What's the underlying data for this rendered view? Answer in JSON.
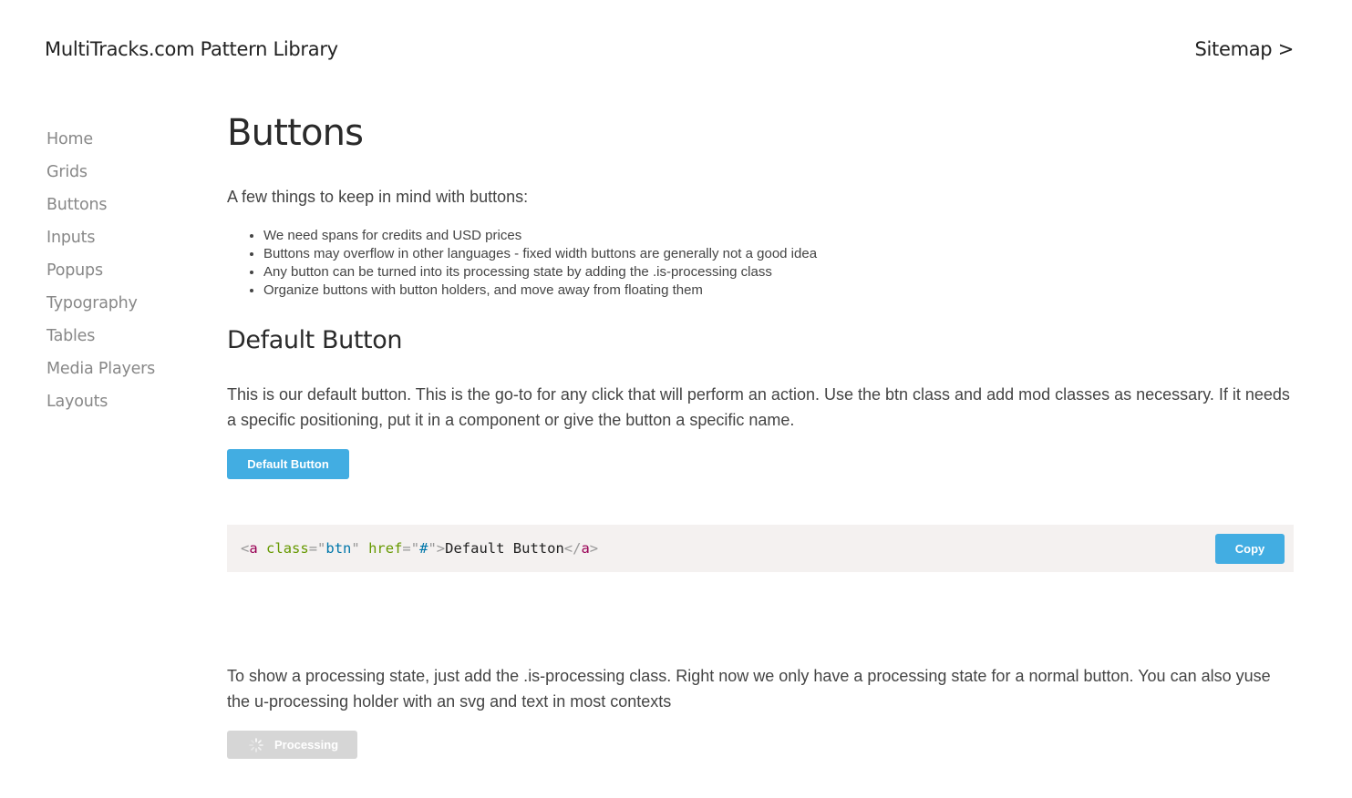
{
  "header": {
    "site_title": "MultiTracks.com Pattern Library",
    "sitemap_link": "Sitemap >"
  },
  "sidebar": {
    "items": [
      {
        "label": "Home"
      },
      {
        "label": "Grids"
      },
      {
        "label": "Buttons"
      },
      {
        "label": "Inputs"
      },
      {
        "label": "Popups"
      },
      {
        "label": "Typography"
      },
      {
        "label": "Tables"
      },
      {
        "label": "Media Players"
      },
      {
        "label": "Layouts"
      }
    ]
  },
  "main": {
    "title": "Buttons",
    "intro": "A few things to keep in mind with buttons:",
    "notes": [
      "We need spans for credits and USD prices",
      "Buttons may overflow in other languages - fixed width buttons are generally not a good idea",
      "Any button can be turned into its processing state by adding the .is-processing class",
      "Organize buttons with button holders, and move away from floating them"
    ],
    "default_section": {
      "title": "Default Button",
      "description": "This is our default button. This is the go-to for any click that will perform an action. Use the btn class and add mod classes as necessary. If it needs a specific positioning, put it in a component or give the button a specific name.",
      "button_label": "Default Button",
      "code": {
        "open_lt": "<",
        "tag": "a",
        "attr_class": "class",
        "eq": "=",
        "quote": "\"",
        "class_value": "btn",
        "attr_href": "href",
        "href_value": "#",
        "gt": ">",
        "text": "Default Button",
        "close_open": "</",
        "close_tag": "a",
        "close_gt": ">"
      },
      "copy_label": "Copy"
    },
    "processing_section": {
      "description": "To show a processing state, just add the .is-processing class. Right now we only have a processing state for a normal button. You can also yuse the u-processing holder with an svg and text in most contexts",
      "button_label": "Processing"
    }
  },
  "colors": {
    "accent": "#42ade2",
    "code_background": "#f4f1f0",
    "processing_button": "#d6d6d6"
  }
}
